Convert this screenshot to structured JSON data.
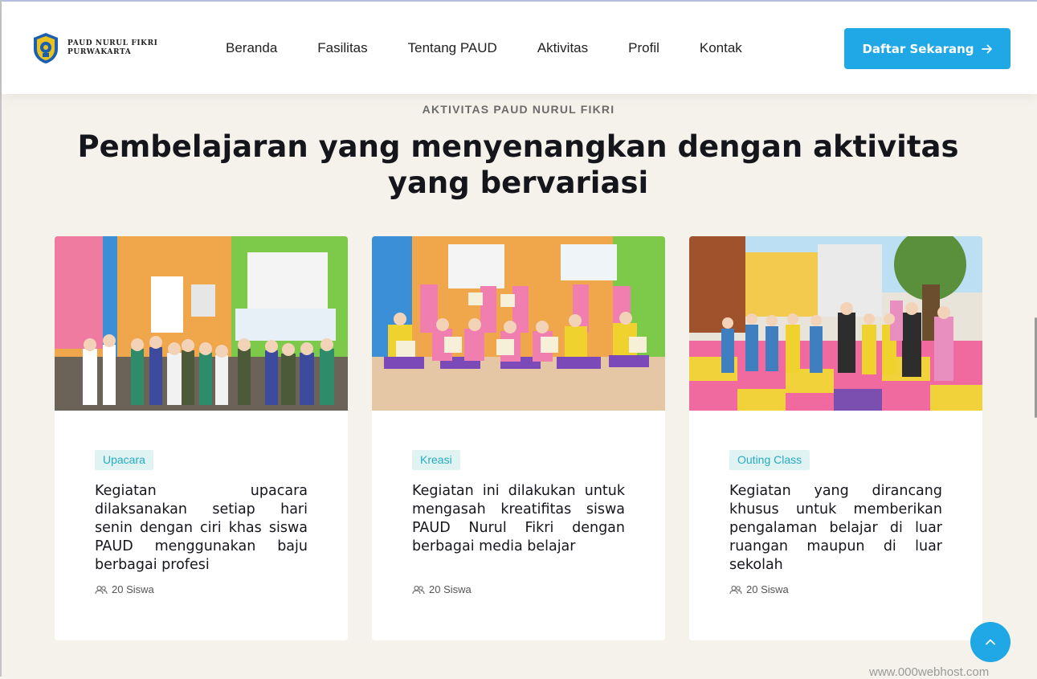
{
  "brand": {
    "line1": "PAUD NURUL FIKRI",
    "line2": "PURWAKARTA"
  },
  "nav": {
    "items": [
      {
        "label": "Beranda"
      },
      {
        "label": "Fasilitas"
      },
      {
        "label": "Tentang PAUD"
      },
      {
        "label": "Aktivitas"
      },
      {
        "label": "Profil"
      },
      {
        "label": "Kontak"
      }
    ],
    "cta_label": "Daftar Sekarang"
  },
  "section": {
    "eyebrow": "AKTIVITAS PAUD NURUL FIKRI",
    "title": "Pembelajaran yang menyenangkan dengan aktivitas yang bervariasi"
  },
  "cards": [
    {
      "category": "Upacara",
      "description": "Kegiatan upacara dilaksanakan setiap hari senin dengan ciri khas siswa PAUD menggunakan baju berbagai profesi",
      "students": "20 Siswa"
    },
    {
      "category": "Kreasi",
      "description": "Kegiatan ini dilakukan untuk mengasah kreatifitas siswa PAUD Nurul Fikri dengan berbagai media belajar",
      "students": "20 Siswa"
    },
    {
      "category": "Outing Class",
      "description": "Kegiatan yang dirancang khusus untuk memberikan pengalaman belajar di luar ruangan maupun di luar sekolah",
      "students": "20 Siswa"
    }
  ],
  "watermark": "www.000webhost.com",
  "colors": {
    "accent": "#1fa7e6",
    "badge_bg": "#dff3f2",
    "badge_text": "#29a9c2",
    "page_bg": "#f5f2ec"
  },
  "icons": {
    "cta": "arrow-right-icon",
    "scroll": "chevron-up-icon",
    "meta": "users-icon"
  }
}
